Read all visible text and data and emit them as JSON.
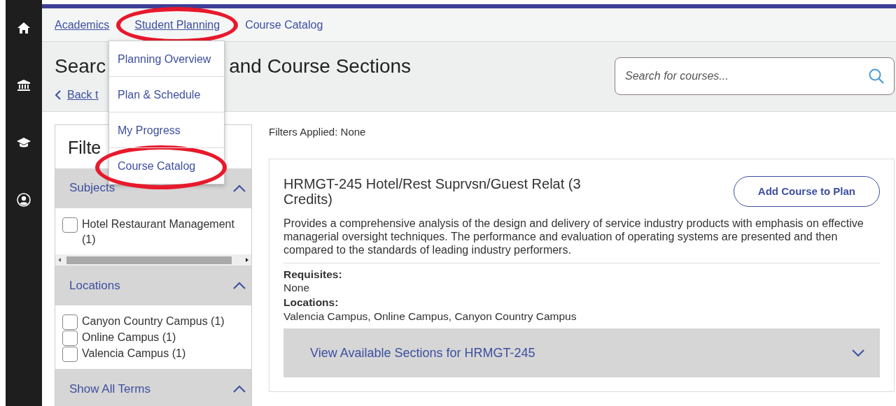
{
  "breadcrumbs": [
    {
      "label": "Academics",
      "kind": "link",
      "highlighted": false
    },
    {
      "label": "Student Planning",
      "kind": "link",
      "highlighted": true
    },
    {
      "label": "Course Catalog",
      "kind": "current",
      "highlighted": false
    }
  ],
  "dropdown_menu": [
    {
      "label": "Planning Overview",
      "highlighted": false
    },
    {
      "label": "Plan & Schedule",
      "highlighted": false
    },
    {
      "label": "My Progress",
      "highlighted": false
    },
    {
      "label": "Course Catalog",
      "highlighted": true
    }
  ],
  "page_title_parts": [
    "Searc",
    "and Course Sections"
  ],
  "back_link": "Back t",
  "search": {
    "placeholder": "Search for courses..."
  },
  "filters": {
    "title": "Filte",
    "groups": [
      {
        "title": "Subjects",
        "expanded": true,
        "options": [
          {
            "label": "Hotel Restaurant Management (1)",
            "checked": false
          }
        ]
      },
      {
        "title": "Locations",
        "expanded": true,
        "options": [
          {
            "label": "Canyon Country Campus (1)",
            "checked": false
          },
          {
            "label": "Online Campus (1)",
            "checked": false
          },
          {
            "label": "Valencia Campus (1)",
            "checked": false
          }
        ]
      },
      {
        "title": "Show All Terms",
        "expanded": true
      }
    ]
  },
  "filters_applied": "Filters Applied: None",
  "courses": [
    {
      "title": "HRMGT-245 Hotel/Rest Suprvsn/Guest Relat (3 Credits)",
      "button": "Add Course to Plan",
      "description": "Provides a comprehensive analysis of the design and delivery of service industry products with emphasis on effective managerial oversight techniques. The performance and evaluation of operating systems are presented and then compared to the standards of leading industry performers.",
      "details": [
        {
          "label": "Requisites:",
          "value": "None"
        },
        {
          "label": "Locations:",
          "value": "Valencia Campus, Online Campus, Canyon Country Campus"
        }
      ],
      "sections_toggle": {
        "label": "View Available Sections for HRMGT-245",
        "expanded": false
      }
    }
  ]
}
